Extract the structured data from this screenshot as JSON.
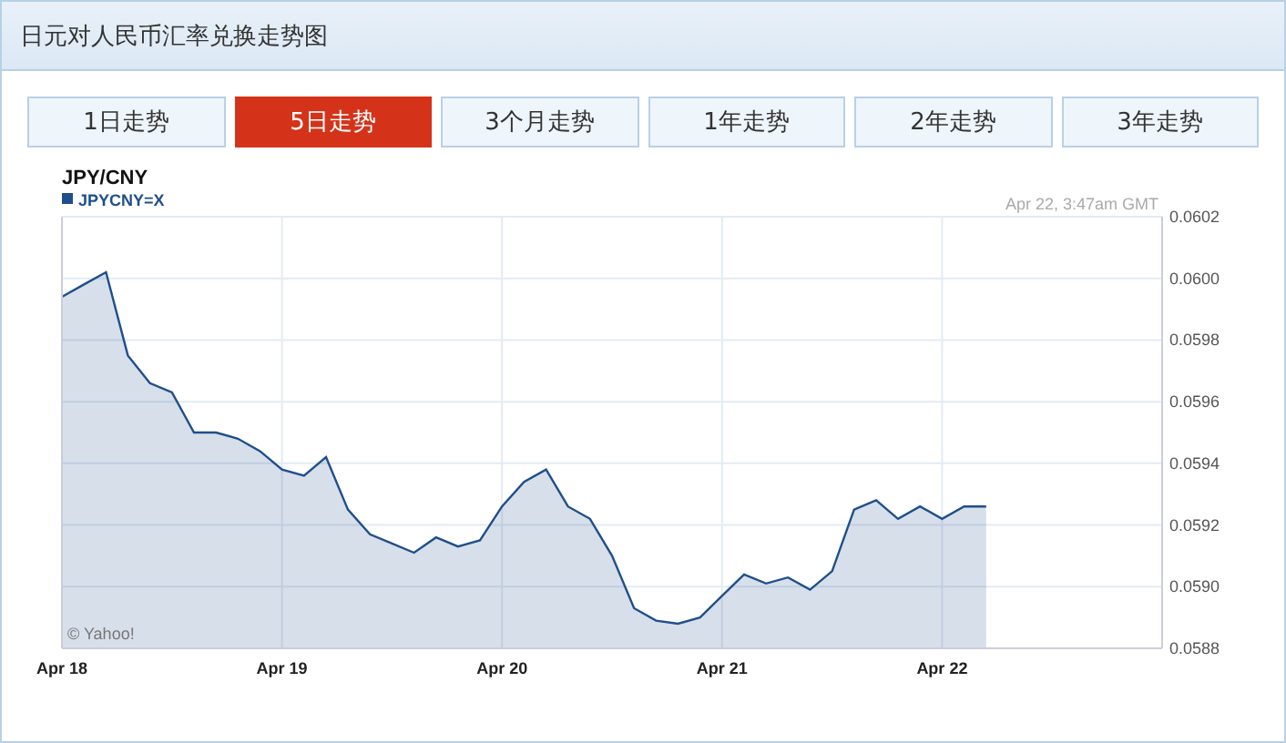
{
  "panel": {
    "title": "日元对人民币汇率兑换走势图"
  },
  "tabs": [
    {
      "label": "1日走势",
      "selected": false
    },
    {
      "label": "5日走势",
      "selected": true
    },
    {
      "label": "3个月走势",
      "selected": false
    },
    {
      "label": "1年走势",
      "selected": false
    },
    {
      "label": "2年走势",
      "selected": false
    },
    {
      "label": "3年走势",
      "selected": false
    }
  ],
  "chart": {
    "timestamp": "Apr 22, 3:47am GMT",
    "credit": "© Yahoo!",
    "chart_data": {
      "type": "area",
      "title": "JPY/CNY",
      "categories": [
        "Apr 18",
        null,
        null,
        null,
        null,
        null,
        null,
        null,
        null,
        null,
        "Apr 19",
        null,
        null,
        null,
        null,
        null,
        null,
        null,
        null,
        null,
        "Apr 20",
        null,
        null,
        null,
        null,
        null,
        null,
        null,
        null,
        null,
        "Apr 21",
        null,
        null,
        null,
        null,
        null,
        null,
        null,
        null,
        null,
        "Apr 22",
        null,
        null,
        null,
        null,
        null,
        null,
        null,
        null,
        null,
        null
      ],
      "series": [
        {
          "name": "JPYCNY=X",
          "color": "#1f4f8a",
          "values": [
            0.05994,
            0.05998,
            0.06002,
            0.05975,
            0.05966,
            0.05963,
            0.0595,
            0.0595,
            0.05948,
            0.05944,
            0.05938,
            0.05936,
            0.05942,
            0.05925,
            0.05917,
            0.05914,
            0.05911,
            0.05916,
            0.05913,
            0.05915,
            0.05926,
            0.05934,
            0.05938,
            0.05926,
            0.05922,
            0.0591,
            0.05893,
            0.05889,
            0.05888,
            0.0589,
            0.05897,
            0.05904,
            0.05901,
            0.05903,
            0.05899,
            0.05905,
            0.05925,
            0.05928,
            0.05922,
            0.05926,
            0.05922,
            0.05926,
            0.05926,
            null,
            null,
            null,
            null,
            null,
            null,
            null,
            null
          ]
        }
      ],
      "ylim": [
        0.0588,
        0.0602
      ],
      "grid": true,
      "yticks": [
        {
          "value": 0.0588,
          "label": "0.0588"
        },
        {
          "value": 0.059,
          "label": "0.0590"
        },
        {
          "value": 0.0592,
          "label": "0.0592"
        },
        {
          "value": 0.0594,
          "label": "0.0594"
        },
        {
          "value": 0.0596,
          "label": "0.0596"
        },
        {
          "value": 0.0598,
          "label": "0.0598"
        },
        {
          "value": 0.06,
          "label": "0.0600"
        },
        {
          "value": 0.0602,
          "label": "0.0602"
        }
      ]
    }
  }
}
